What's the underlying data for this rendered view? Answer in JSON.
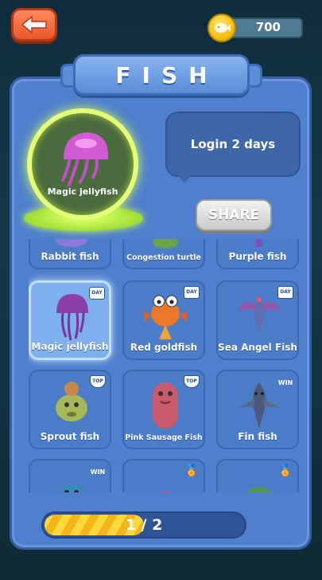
{
  "header": {
    "back_icon": "arrow-left-icon",
    "coins": "700",
    "coin_icon": "gold-fish-coin-icon"
  },
  "panel": {
    "title": "FISH"
  },
  "featured": {
    "name": "Magic jellyfish",
    "message": "Login 2 days",
    "share_label": "SHARE"
  },
  "grid": {
    "row0": [
      {
        "name": "Rabbit fish",
        "badge": ""
      },
      {
        "name": "Congestion turtle",
        "badge": ""
      },
      {
        "name": "Purple fish",
        "badge": ""
      }
    ],
    "row1": [
      {
        "name": "Magic jellyfish",
        "badge": "DAY",
        "selected": true
      },
      {
        "name": "Red goldfish",
        "badge": "DAY"
      },
      {
        "name": "Sea Angel Fish",
        "badge": "DAY"
      }
    ],
    "row2": [
      {
        "name": "Sprout fish",
        "badge": "TOP"
      },
      {
        "name": "Pink Sausage Fish",
        "badge": "TOP"
      },
      {
        "name": "Fin fish",
        "badge": "WIN"
      }
    ],
    "row3": [
      {
        "name": "",
        "badge": "WIN"
      },
      {
        "name": "",
        "badge": "ribbon"
      },
      {
        "name": "",
        "badge": "ribbon"
      }
    ]
  },
  "progress": {
    "current": 1,
    "total": 2,
    "text": "1 / 2",
    "fraction": 0.5
  },
  "colors": {
    "panel": "#4f7fcd",
    "glow": "#e6ff7a",
    "back_button": "#e8582b",
    "coin": "#f7c21b"
  }
}
